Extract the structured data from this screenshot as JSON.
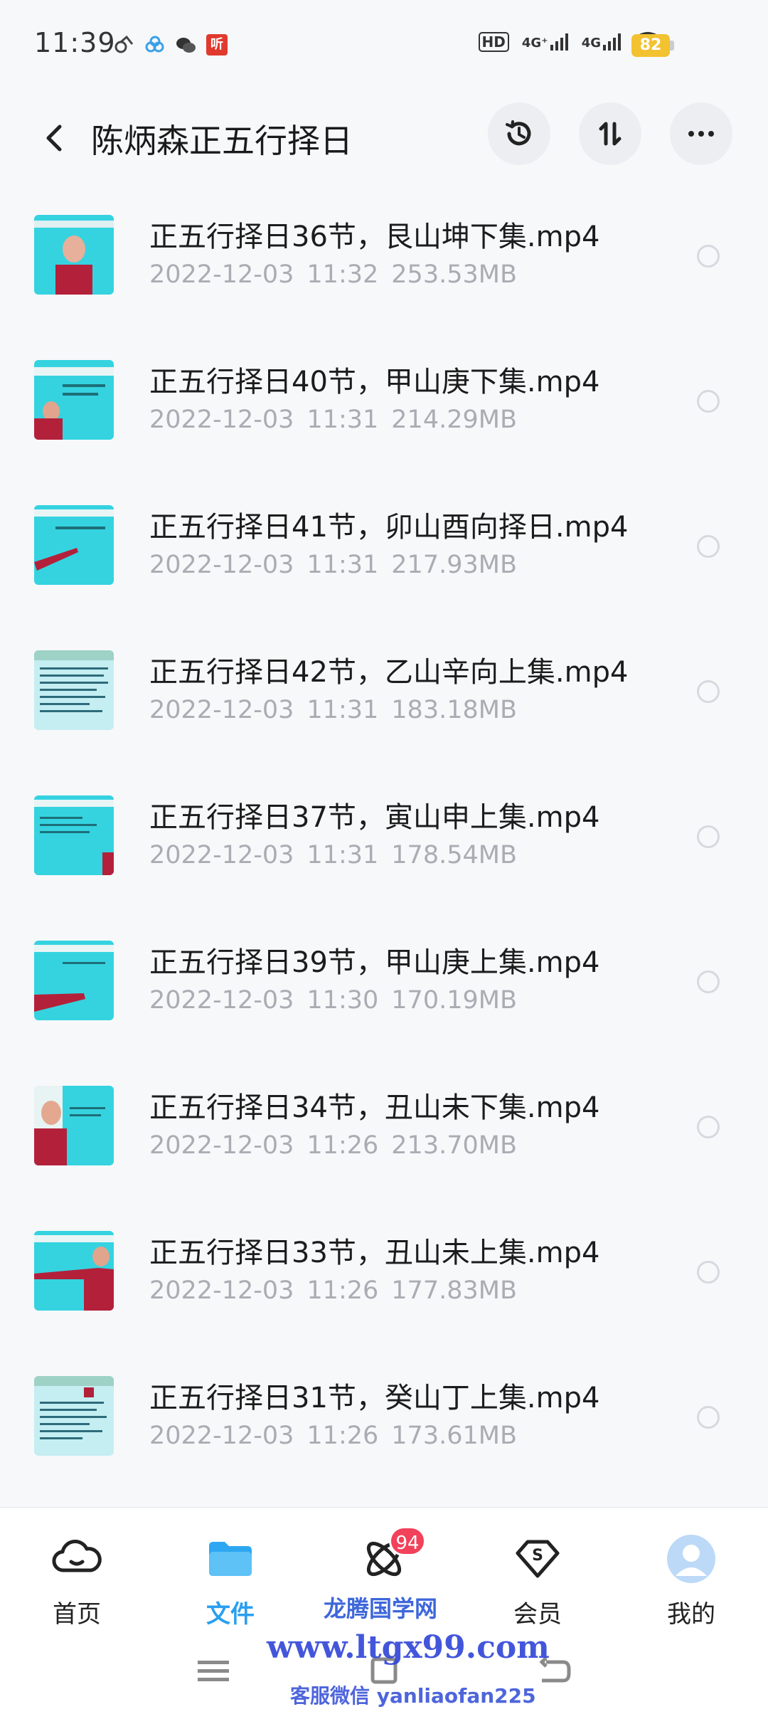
{
  "status": {
    "time": "11:39",
    "hd": "HD",
    "sim1": "4G⁺",
    "sim2": "4G",
    "battery": "82"
  },
  "header": {
    "title": "陈炳森正五行择日",
    "history_icon": "history-icon",
    "sort_icon": "sort-icon",
    "more_icon": "more-icon"
  },
  "files": [
    {
      "name": "正五行择日36节，艮山坤下集.mp4",
      "date": "2022-12-03",
      "time": "11:32",
      "size": "253.53MB"
    },
    {
      "name": "正五行择日40节，甲山庚下集.mp4",
      "date": "2022-12-03",
      "time": "11:31",
      "size": "214.29MB"
    },
    {
      "name": "正五行择日41节，卯山酉向择日.mp4",
      "date": "2022-12-03",
      "time": "11:31",
      "size": "217.93MB"
    },
    {
      "name": "正五行择日42节，乙山辛向上集.mp4",
      "date": "2022-12-03",
      "time": "11:31",
      "size": "183.18MB"
    },
    {
      "name": "正五行择日37节，寅山申上集.mp4",
      "date": "2022-12-03",
      "time": "11:31",
      "size": "178.54MB"
    },
    {
      "name": "正五行择日39节，甲山庚上集.mp4",
      "date": "2022-12-03",
      "time": "11:30",
      "size": "170.19MB"
    },
    {
      "name": "正五行择日34节，丑山未下集.mp4",
      "date": "2022-12-03",
      "time": "11:26",
      "size": "213.70MB"
    },
    {
      "name": "正五行择日33节，丑山未上集.mp4",
      "date": "2022-12-03",
      "time": "11:26",
      "size": "177.83MB"
    },
    {
      "name": "正五行择日31节，癸山丁上集.mp4",
      "date": "2022-12-03",
      "time": "11:26",
      "size": "173.61MB"
    }
  ],
  "nav": {
    "home": "首页",
    "files": "文件",
    "third": "",
    "third_badge": "94",
    "vip": "会员",
    "me": "我的"
  },
  "watermark": {
    "line1": "龙腾国学网",
    "line2": "www.ltgx99.com",
    "line3": "客服微信 yanliaofan225"
  },
  "colors": {
    "accent": "#2a9ff0",
    "badge": "#f2415a",
    "battery": "#f2c230"
  }
}
